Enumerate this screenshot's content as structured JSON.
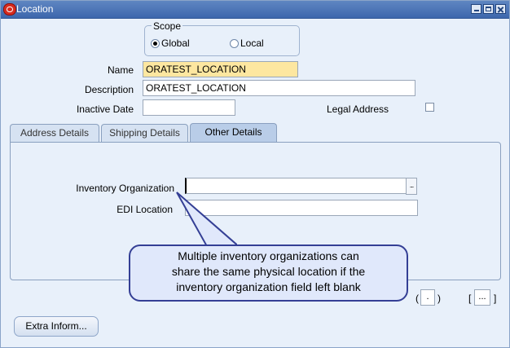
{
  "window": {
    "title": "Location"
  },
  "scope": {
    "legend": "Scope",
    "options": [
      {
        "label": "Global",
        "selected": true
      },
      {
        "label": "Local",
        "selected": false
      }
    ]
  },
  "form": {
    "name_label": "Name",
    "name_value": "ORATEST_LOCATION",
    "description_label": "Description",
    "description_value": "ORATEST_LOCATION",
    "inactive_date_label": "Inactive Date",
    "inactive_date_value": "",
    "legal_address_label": "Legal Address",
    "legal_address_checked": false
  },
  "tabs": [
    {
      "label": "Address Details",
      "active": false
    },
    {
      "label": "Shipping Details",
      "active": false
    },
    {
      "label": "Other Details",
      "active": true
    }
  ],
  "other_details": {
    "inventory_org_label": "Inventory Organization",
    "inventory_org_value": "",
    "lov_button": "...",
    "edi_location_label": "EDI Location",
    "edi_location_value": ""
  },
  "callout": {
    "lines": [
      "Multiple inventory organizations can",
      "share the same physical location if the",
      "inventory organization field left blank"
    ]
  },
  "flex_fields": {
    "left_open": "(",
    "left_value": ".",
    "left_close": ")",
    "right_open": "[",
    "right_value": "...",
    "right_close": "]"
  },
  "buttons": {
    "extra_info": "Extra Inform..."
  },
  "colors": {
    "titlebar": "#3d67ad",
    "required_field": "#fde7a0",
    "callout_border": "#343f95"
  }
}
